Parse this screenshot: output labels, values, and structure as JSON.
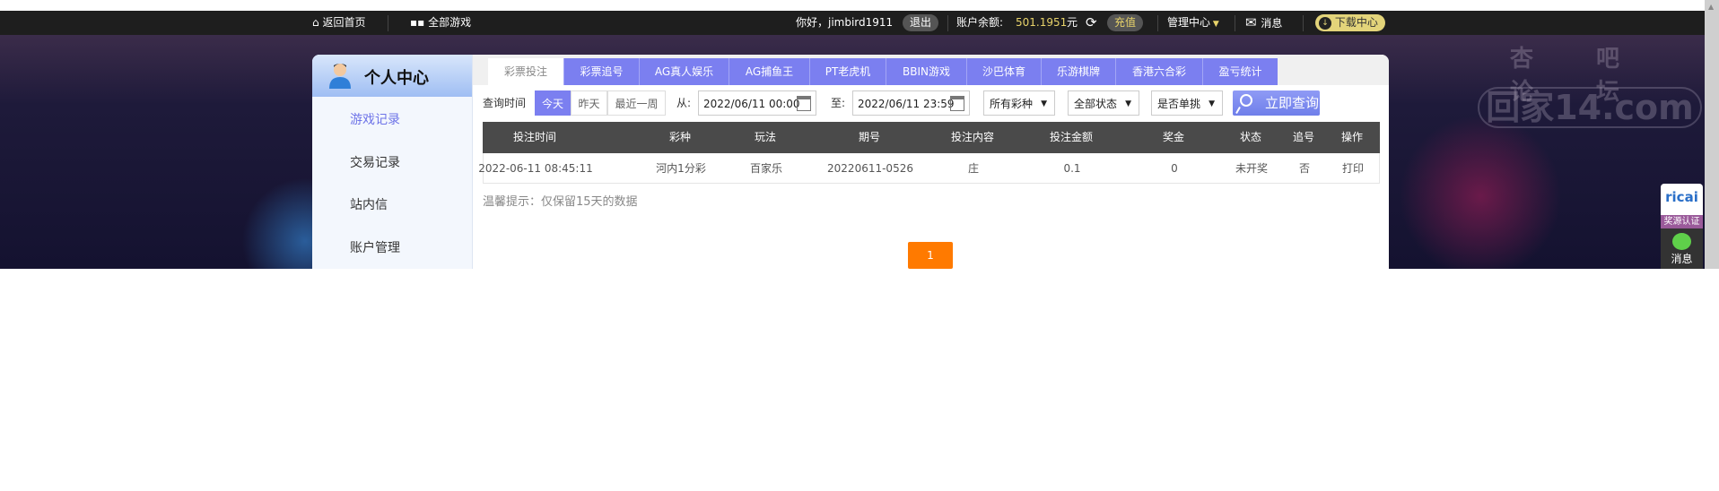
{
  "topbar": {
    "home": "返回首页",
    "all_games": "全部游戏",
    "greeting": "你好，jimbird1911",
    "logout": "退出",
    "balance_label": "账户余额:",
    "balance": "501.1951",
    "currency": "元",
    "recharge": "充值",
    "manage": "管理中心",
    "messages": "消息",
    "download": "下载中心",
    "balance_color": "#e8d36a"
  },
  "watermark": {
    "line1": "杏吧论坛",
    "line2": "回家14.com"
  },
  "sidebar": {
    "title": "个人中心",
    "items": [
      {
        "label": "游戏记录",
        "active": true
      },
      {
        "label": "交易记录"
      },
      {
        "label": "站内信"
      },
      {
        "label": "账户管理"
      }
    ]
  },
  "tabs": [
    "彩票投注",
    "彩票追号",
    "AG真人娱乐",
    "AG捕鱼王",
    "PT老虎机",
    "BBIN游戏",
    "沙巴体育",
    "乐游棋牌",
    "香港六合彩",
    "盈亏统计"
  ],
  "filter": {
    "label": "查询时间",
    "ranges": [
      "今天",
      "昨天",
      "最近一周"
    ],
    "from_label": "从:",
    "from": "2022/06/11 00:00",
    "to_label": "至:",
    "to": "2022/06/11 23:59",
    "lottery": "所有彩种",
    "status": "全部状态",
    "single": "是否单挑",
    "query": "立即查询"
  },
  "table": {
    "headers": [
      "投注时间",
      "彩种",
      "玩法",
      "期号",
      "投注内容",
      "投注金额",
      "奖金",
      "状态",
      "追号",
      "操作"
    ],
    "rows": [
      [
        "2022-06-11 08:45:11",
        "河内1分彩",
        "百家乐",
        "20220611-0526",
        "庄",
        "0.1",
        "0",
        "未开奖",
        "否",
        "打印"
      ]
    ]
  },
  "tip": "温馨提示：仅保留15天的数据",
  "pagination": {
    "current": "1"
  },
  "widget": {
    "brand": "ricai",
    "badge": "奖源认证",
    "messages": "消息"
  },
  "colors": {
    "accent": "#7b7ff0",
    "page_button": "#ff7a00"
  }
}
